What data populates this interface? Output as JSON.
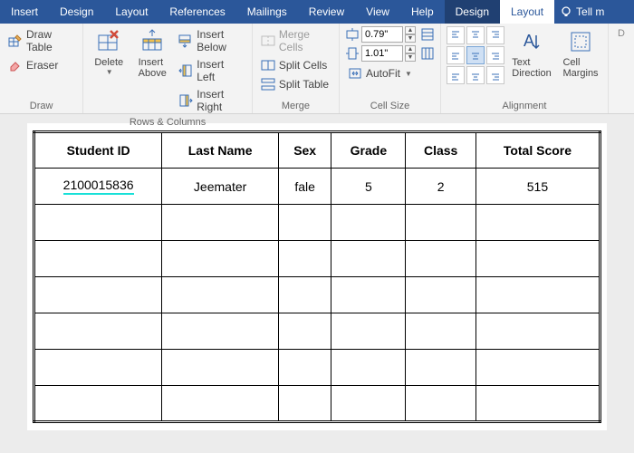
{
  "tabs": {
    "insert": "Insert",
    "design": "Design",
    "layout": "Layout",
    "references": "References",
    "mailings": "Mailings",
    "review": "Review",
    "view": "View",
    "help": "Help",
    "tbl_design": "Design",
    "tbl_layout": "Layout",
    "tell": "Tell m"
  },
  "draw": {
    "draw_table": "Draw Table",
    "eraser": "Eraser",
    "group": "Draw"
  },
  "rowscols": {
    "delete": "Delete",
    "insert_above": "Insert Above",
    "insert_below": "Insert Below",
    "insert_left": "Insert Left",
    "insert_right": "Insert Right",
    "group": "Rows & Columns"
  },
  "merge": {
    "merge_cells": "Merge Cells",
    "split_cells": "Split Cells",
    "split_table": "Split Table",
    "group": "Merge"
  },
  "cellsize": {
    "height": "0.79\"",
    "width": "1.01\"",
    "autofit": "AutoFit",
    "group": "Cell Size"
  },
  "alignment": {
    "text_direction": "Text Direction",
    "cell_margins": "Cell Margins",
    "group": "Alignment"
  },
  "table": {
    "headers": [
      "Student ID",
      "Last Name",
      "Sex",
      "Grade",
      "Class",
      "Total Score"
    ],
    "rows": [
      [
        "2100015836",
        "Jeemater",
        "fale",
        "5",
        "2",
        "515"
      ],
      [
        "",
        "",
        "",
        "",
        "",
        ""
      ],
      [
        "",
        "",
        "",
        "",
        "",
        ""
      ],
      [
        "",
        "",
        "",
        "",
        "",
        ""
      ],
      [
        "",
        "",
        "",
        "",
        "",
        ""
      ],
      [
        "",
        "",
        "",
        "",
        "",
        ""
      ],
      [
        "",
        "",
        "",
        "",
        "",
        ""
      ]
    ]
  }
}
